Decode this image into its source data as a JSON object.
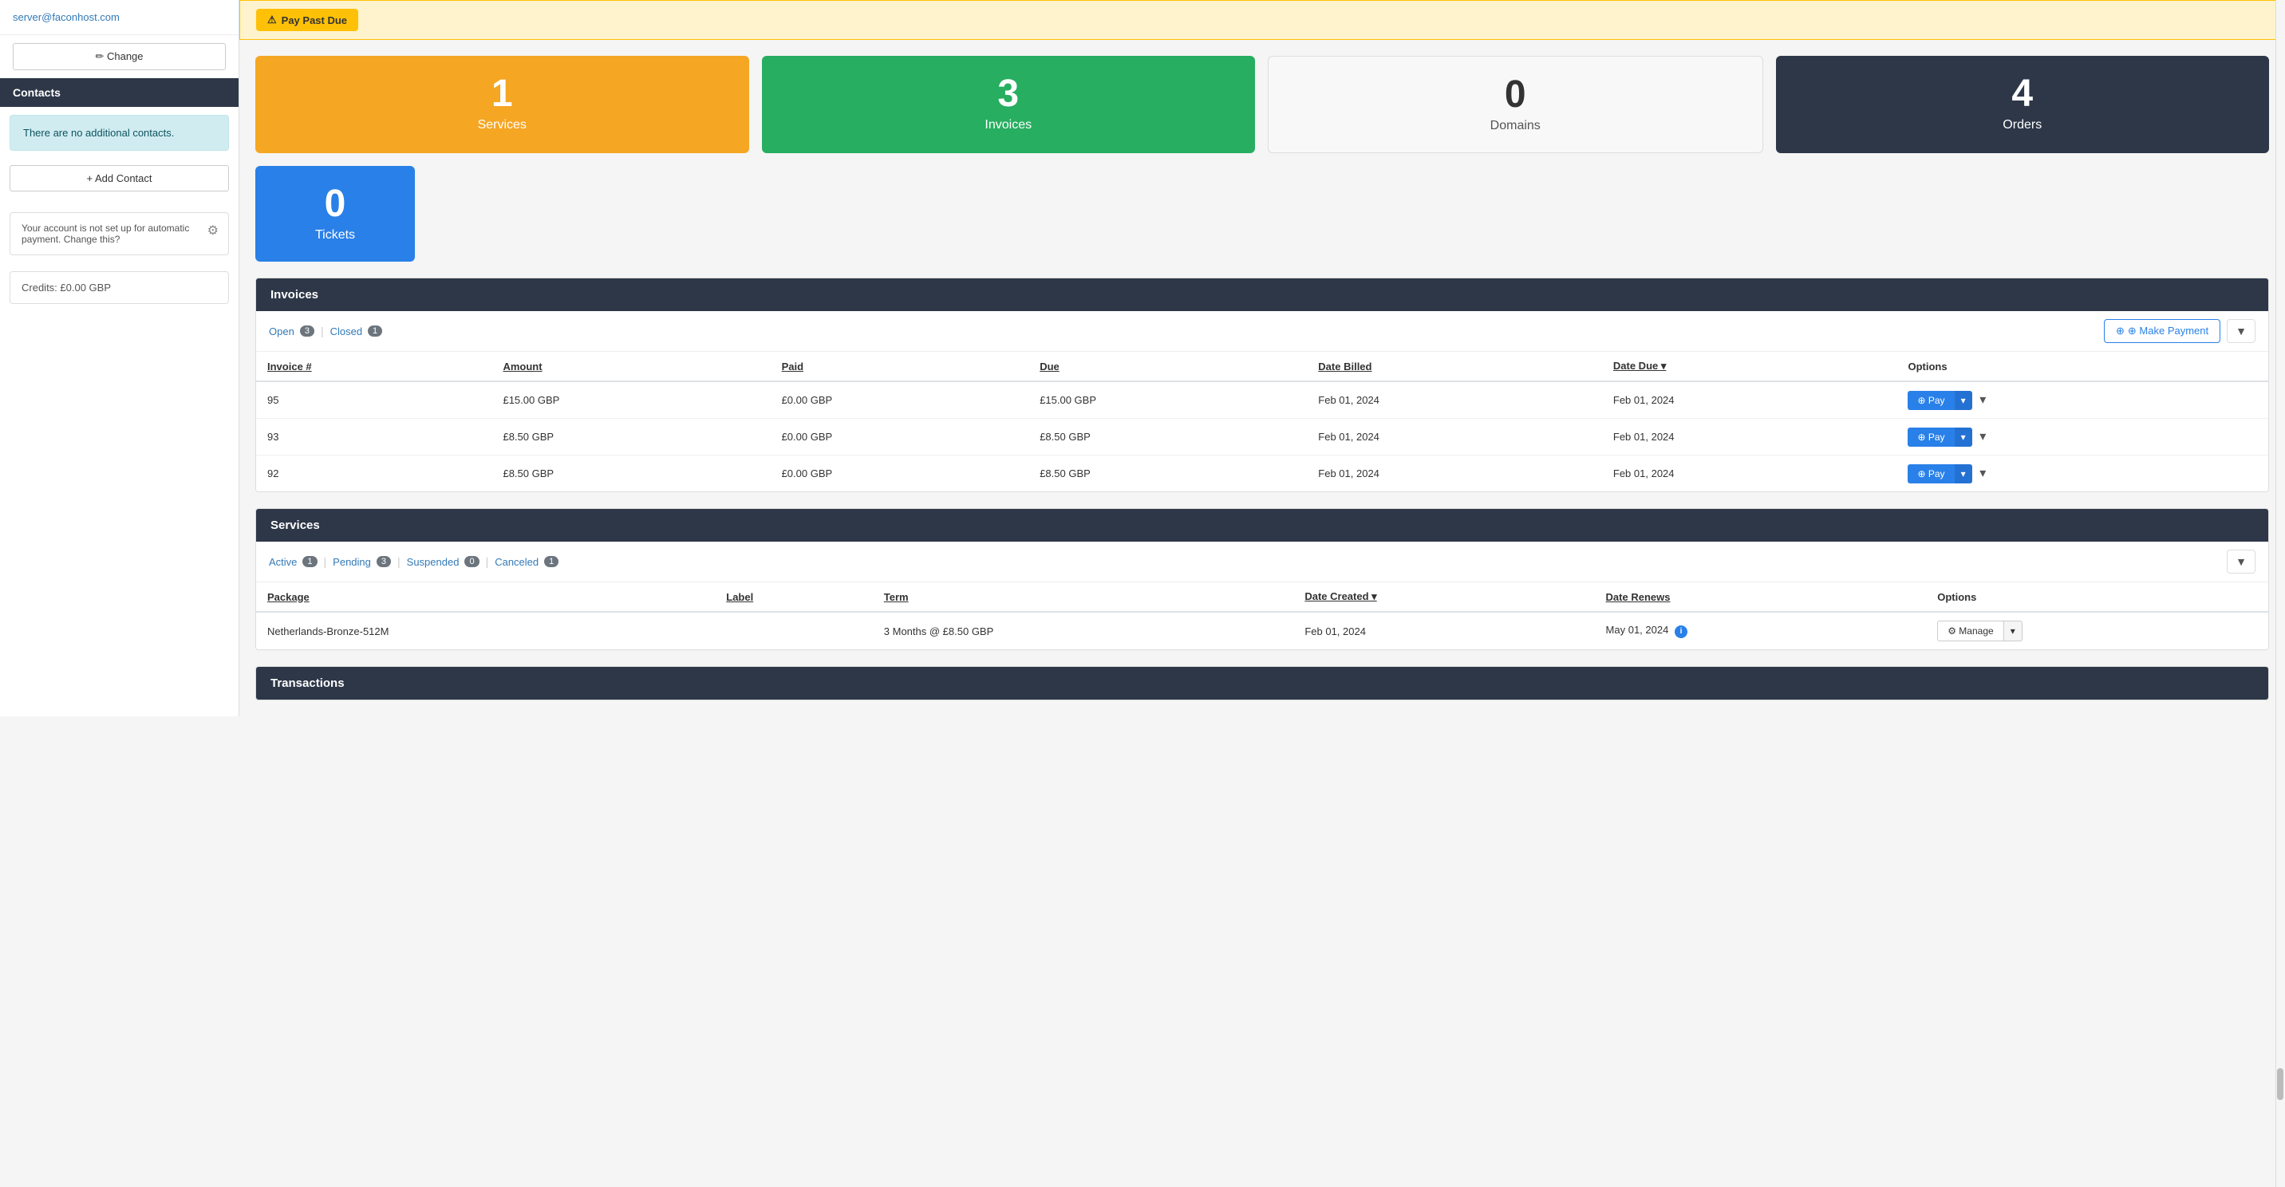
{
  "sidebar": {
    "email": "server@faconhost.com",
    "change_btn": "✏ Change",
    "contacts_header": "Contacts",
    "contacts_empty": "There are no additional contacts.",
    "add_contact_btn": "+ Add Contact",
    "autopay_text": "Your account is not set up for automatic payment. Change this?",
    "credits_label": "Credits: £0.00 GBP"
  },
  "banner": {
    "icon": "⚠",
    "label": "Pay Past Due"
  },
  "stats": [
    {
      "number": "1",
      "label": "Services",
      "color": "orange"
    },
    {
      "number": "3",
      "label": "Invoices",
      "color": "green"
    },
    {
      "number": "0",
      "label": "Domains",
      "color": "light"
    },
    {
      "number": "4",
      "label": "Orders",
      "color": "dark"
    }
  ],
  "tickets_stat": {
    "number": "0",
    "label": "Tickets",
    "color": "blue"
  },
  "invoices_section": {
    "title": "Invoices",
    "tabs": [
      {
        "label": "Open",
        "badge": "3"
      },
      {
        "label": "Closed",
        "badge": "1"
      }
    ],
    "make_payment_btn": "⊕ Make Payment",
    "columns": [
      "Invoice #",
      "Amount",
      "Paid",
      "Due",
      "Date Billed",
      "Date Due ▾",
      "Options"
    ],
    "rows": [
      {
        "invoice": "95",
        "amount": "£15.00 GBP",
        "paid": "£0.00 GBP",
        "due": "£15.00 GBP",
        "date_billed": "Feb 01, 2024",
        "date_due": "Feb 01, 2024",
        "date_due_red": true
      },
      {
        "invoice": "93",
        "amount": "£8.50 GBP",
        "paid": "£0.00 GBP",
        "due": "£8.50 GBP",
        "date_billed": "Feb 01, 2024",
        "date_due": "Feb 01, 2024",
        "date_due_red": true
      },
      {
        "invoice": "92",
        "amount": "£8.50 GBP",
        "paid": "£0.00 GBP",
        "due": "£8.50 GBP",
        "date_billed": "Feb 01, 2024",
        "date_due": "Feb 01, 2024",
        "date_due_red": true
      }
    ],
    "pay_btn": "⊕ Pay"
  },
  "services_section": {
    "title": "Services",
    "tabs": [
      {
        "label": "Active",
        "badge": "1"
      },
      {
        "label": "Pending",
        "badge": "3"
      },
      {
        "label": "Suspended",
        "badge": "0"
      },
      {
        "label": "Canceled",
        "badge": "1"
      }
    ],
    "columns": [
      "Package",
      "Label",
      "Term",
      "Date Created ▾",
      "Date Renews",
      "Options"
    ],
    "rows": [
      {
        "package": "Netherlands-Bronze-512M",
        "label": "",
        "term": "3 Months @ £8.50 GBP",
        "date_created": "Feb 01, 2024",
        "date_renews": "May 01, 2024"
      }
    ],
    "manage_btn": "⚙ Manage"
  },
  "transactions_section": {
    "title": "Transactions"
  }
}
